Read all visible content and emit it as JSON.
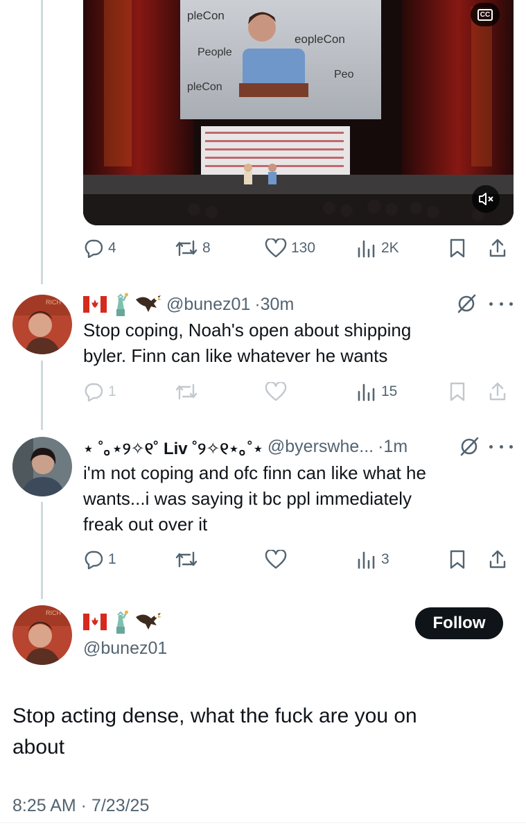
{
  "video": {
    "cc_label": "CC",
    "banner_brand": "PeopleCon"
  },
  "main_tweet_actions": {
    "replies": "4",
    "retweets": "8",
    "likes": "130",
    "views": "2K"
  },
  "reply1": {
    "flags": [
      "canada-flag",
      "statue-of-liberty",
      "eagle"
    ],
    "handle": "@bunez01",
    "time": "·30m",
    "text_line1": "Stop coping, Noah's open about shipping",
    "text_line2": "byler. Finn can like whatever he wants",
    "replies": "1",
    "retweets": "",
    "likes": "",
    "views": "15"
  },
  "reply2": {
    "display_name_pre": "⋆ ˚｡⋆୨✧୧˚ ",
    "display_name_core": "Liv",
    "display_name_post": " ˚୨✧୧⋆｡˚⋆",
    "handle": "@byerswhe...",
    "time": "·1m",
    "text_line1": "i'm not coping and ofc finn can like what he",
    "text_line2": "wants...i was saying it bc ppl immediately",
    "text_line3": "freak out over it",
    "replies": "1",
    "retweets": "",
    "likes": "",
    "views": "3"
  },
  "focused_tweet": {
    "handle": "@bunez01",
    "follow_label": "Follow",
    "text_line1": "Stop acting dense, what the fuck are you on",
    "text_line2": "about",
    "timestamp": "8:25 AM · 7/23/25"
  },
  "colors": {
    "text": "#0f1419",
    "muted": "#536471",
    "thread_line": "#cfd9de"
  }
}
